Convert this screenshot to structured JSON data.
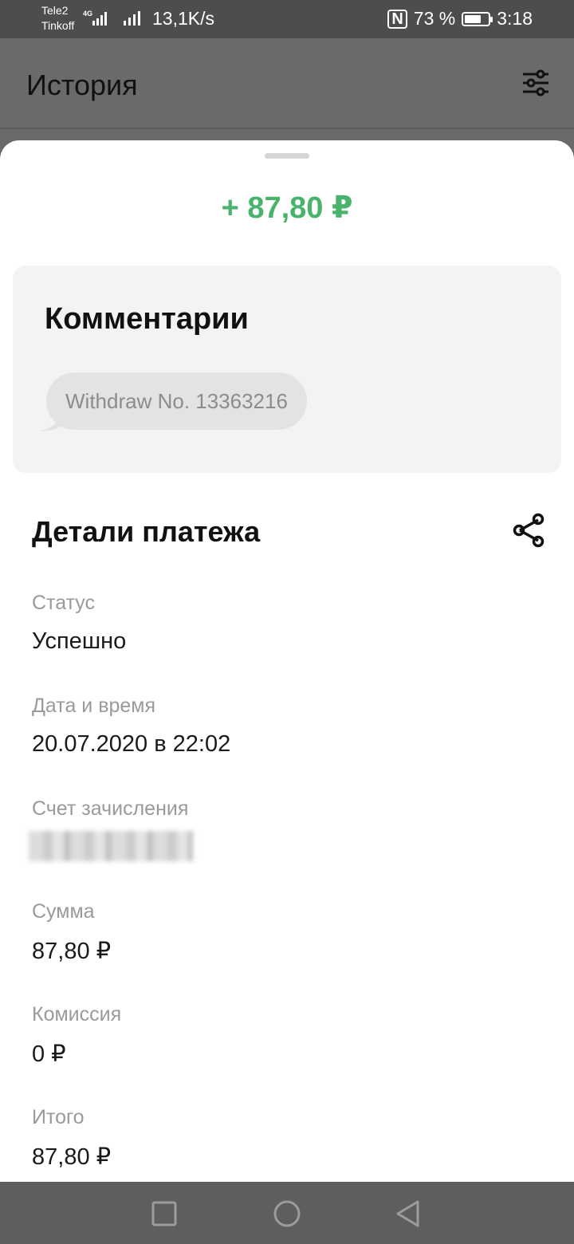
{
  "status_bar": {
    "carrier_1": "Tele2",
    "carrier_2": "Tinkoff",
    "network": "4G",
    "speed": "13,1K/s",
    "nfc": "N",
    "battery": "73 %",
    "battery_level": 0.73,
    "time": "3:18"
  },
  "app_bar": {
    "title": "История",
    "filter_icon": "sliders-icon"
  },
  "sheet": {
    "amount": "+ 87,80 ₽",
    "amount_color": "#47b36b",
    "comments": {
      "title": "Комментарии",
      "message": "Withdraw No. 13363216"
    },
    "details": {
      "title": "Детали платежа",
      "share_icon": "share-icon",
      "fields": [
        {
          "label": "Статус",
          "value": "Успешно"
        },
        {
          "label": "Дата и время",
          "value": "20.07.2020 в 22:02"
        },
        {
          "label": "Счет зачисления",
          "value": ""
        },
        {
          "label": "Сумма",
          "value": "87,80 ₽"
        },
        {
          "label": "Комиссия",
          "value": "0 ₽"
        },
        {
          "label": "Итого",
          "value": "87,80 ₽"
        }
      ]
    }
  },
  "nav_bar": {
    "recents": "square-icon",
    "home": "circle-icon",
    "back": "triangle-back-icon"
  }
}
